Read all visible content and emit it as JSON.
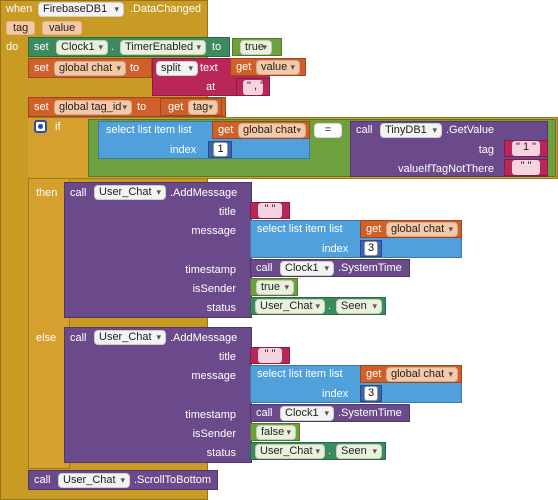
{
  "event": {
    "when": "when",
    "component": "FirebaseDB1",
    "event_name": ".DataChanged",
    "params": [
      "tag",
      "value"
    ],
    "do": "do"
  },
  "keywords": {
    "set": "set",
    "to": "to",
    "get": "get",
    "call": "call",
    "if": "if",
    "then": "then",
    "else": "else",
    "text": "text",
    "at": "at",
    "index": "index",
    "split": "split",
    "dot": "."
  },
  "stmt1": {
    "component": "Clock1",
    "prop": "TimerEnabled",
    "value": "true"
  },
  "stmt2": {
    "var": "global chat",
    "split_label": "split",
    "get_var": "value",
    "at_text": ","
  },
  "stmt3": {
    "var": "global tag_id",
    "get_var": "tag"
  },
  "if_block": {
    "select": "select list item  list",
    "get_var": "global chat",
    "index_value": "1",
    "op": "=",
    "db_component": "TinyDB1",
    "db_method": ".GetValue",
    "tag_label": "tag",
    "tag_value": "1",
    "not_there_label": "valueIfTagNotThere",
    "not_there_value": ""
  },
  "then_block": {
    "component": "User_Chat",
    "method": ".AddMessage",
    "params": [
      "title",
      "message",
      "timestamp",
      "isSender",
      "status"
    ],
    "title_value": "",
    "select": "select list item  list",
    "get_var": "global chat",
    "index_value": "3",
    "clock": "Clock1",
    "clock_method": ".SystemTime",
    "sender": "true",
    "status_component": "User_Chat",
    "status_prop": "Seen"
  },
  "else_block": {
    "component": "User_Chat",
    "method": ".AddMessage",
    "params": [
      "title",
      "message",
      "timestamp",
      "isSender",
      "status"
    ],
    "title_value": "",
    "select": "select list item  list",
    "get_var": "global chat",
    "index_value": "3",
    "clock": "Clock1",
    "clock_method": ".SystemTime",
    "sender": "false",
    "status_component": "User_Chat",
    "status_prop": "Seen"
  },
  "final_call": {
    "component": "User_Chat",
    "method": ".ScrollToBottom"
  },
  "colors": {
    "event": "#c99a24",
    "variable": "#d0602a",
    "text": "#b8265a",
    "list": "#50a1db",
    "math": "#3c63b0",
    "logic": "#6ea13e",
    "component": "#6b4a8b",
    "component_prop": "#3c8b5e"
  }
}
